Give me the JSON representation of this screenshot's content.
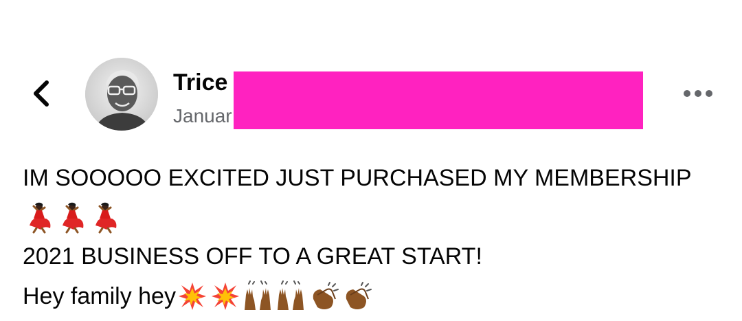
{
  "colors": {
    "redaction": "#ff22c0",
    "secondary_text": "#65676b",
    "primary_text": "#050505"
  },
  "header": {
    "back_icon": "chevron-left-icon",
    "author_name": "Trice",
    "date": "Januar",
    "more_icon": "more-horizontal-icon"
  },
  "post": {
    "line1": "IM SOOOOO EXCITED JUST PURCHASED MY MEMBERSHIP",
    "line2_emojis": [
      "dancer-emoji",
      "dancer-emoji",
      "dancer-emoji"
    ],
    "line3": "2021 BUSINESS OFF TO A GREAT START!",
    "line4_text": "Hey family hey",
    "line4_emojis": [
      "collision-emoji",
      "collision-emoji",
      "raising-hands-emoji",
      "raising-hands-emoji",
      "clapping-hands-emoji",
      "clapping-hands-emoji"
    ]
  }
}
